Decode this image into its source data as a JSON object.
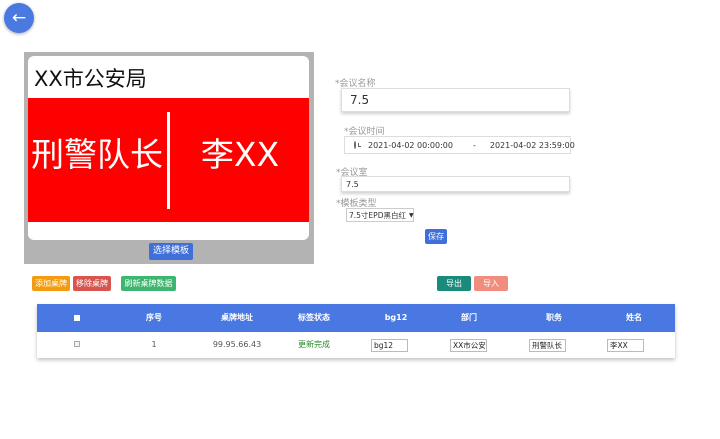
{
  "back_button": {
    "icon": "arrow-left-icon",
    "glyph": "←"
  },
  "preview": {
    "org": "XX市公安局",
    "role": "刑警队长",
    "name": "李XX",
    "select_template_label": "选择模板",
    "bg_color": "#ff0000"
  },
  "form": {
    "meeting_name_label": "*会议名称",
    "meeting_name_value": "7.5",
    "meeting_time_label": "*会议时间",
    "time_start": "2021-04-02 00:00:00",
    "time_separator": "-",
    "time_end": "2021-04-02 23:59:00",
    "meeting_room_label": "*会议室",
    "meeting_room_value": "7.5",
    "template_type_label": "*模板类型",
    "template_type_value": "7.5寸EPD黑白红",
    "save_label": "保存"
  },
  "actions": {
    "add_label": "添加桌牌",
    "remove_label": "移除桌牌",
    "refresh_label": "刷新桌牌数据",
    "export_label": "导出",
    "import_label": "导入"
  },
  "colors": {
    "primary": "#3f6fd8",
    "add": "#f39c12",
    "remove": "#d9534f",
    "refresh": "#3fb66f",
    "export": "#1a8a7a",
    "import": "#f08d7e"
  },
  "table": {
    "headers": [
      "■",
      "序号",
      "桌牌地址",
      "标签状态",
      "bg12",
      "部门",
      "职务",
      "姓名"
    ],
    "rows": [
      {
        "index": "1",
        "address": "99.95.66.43",
        "status": "更新完成",
        "bg12": "bg12",
        "department": "XX市公安局",
        "position": "刑警队长",
        "name": "李XX"
      }
    ]
  }
}
